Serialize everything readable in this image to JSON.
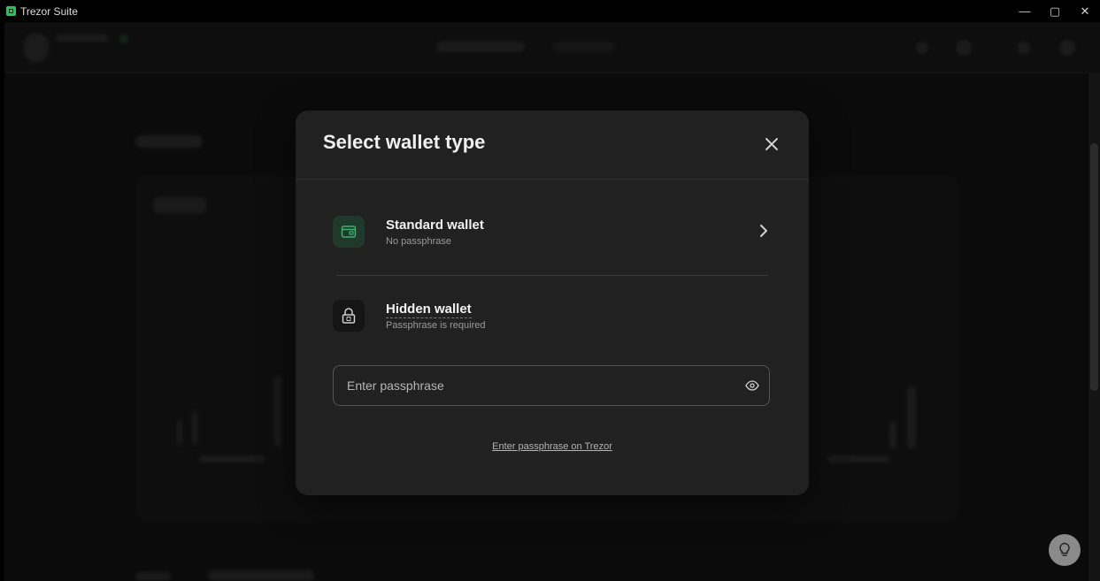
{
  "window": {
    "title": "Trezor Suite",
    "controls": {
      "minimize": "—",
      "maximize": "▢",
      "close": "✕"
    }
  },
  "modal": {
    "title": "Select wallet type",
    "standard_wallet": {
      "title": "Standard wallet",
      "subtitle": "No passphrase",
      "icon": "wallet-icon"
    },
    "hidden_wallet": {
      "title": "Hidden wallet",
      "subtitle": "Passphrase is required",
      "icon": "lock-icon"
    },
    "passphrase_input": {
      "placeholder": "Enter passphrase",
      "value": ""
    },
    "trezor_link": "Enter passphrase on Trezor"
  },
  "colors": {
    "accent_green": "#1f3a2b",
    "modal_bg": "#212121",
    "app_bg": "#111111"
  }
}
